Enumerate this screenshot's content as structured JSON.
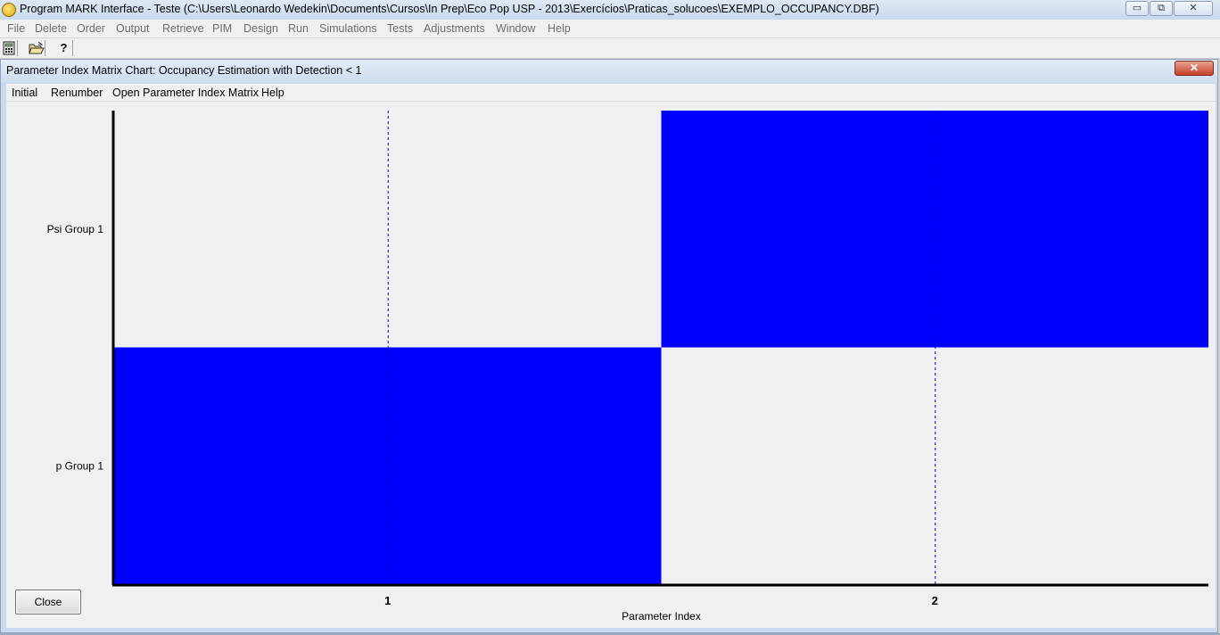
{
  "app": {
    "title": "Program MARK Interface - Teste  (C:\\Users\\Leonardo Wedekin\\Documents\\Cursos\\In Prep\\Eco Pop USP - 2013\\Exercícios\\Praticas_solucoes\\EXEMPLO_OCCUPANCY.DBF)",
    "window_controls": {
      "minimize": "▭",
      "restore": "⧉",
      "close": "✕"
    }
  },
  "menubar": {
    "items": [
      {
        "label": "File",
        "enabled": false
      },
      {
        "label": "Delete",
        "enabled": false
      },
      {
        "label": "Order",
        "enabled": false
      },
      {
        "label": "Output",
        "enabled": false
      },
      {
        "label": "Retrieve",
        "enabled": false
      },
      {
        "label": "PIM",
        "enabled": false
      },
      {
        "label": "Design",
        "enabled": false
      },
      {
        "label": "Run",
        "enabled": false
      },
      {
        "label": "Simulations",
        "enabled": false
      },
      {
        "label": "Tests",
        "enabled": false
      },
      {
        "label": "Adjustments",
        "enabled": false
      },
      {
        "label": "Window",
        "enabled": false
      },
      {
        "label": "Help",
        "enabled": false
      }
    ]
  },
  "toolbar": {
    "buttons": [
      {
        "icon": "calculator-icon"
      },
      {
        "icon": "open-folder-icon"
      },
      {
        "icon": "help-icon",
        "label": "?"
      }
    ]
  },
  "child_window": {
    "title": "Parameter Index Matrix Chart: Occupancy Estimation with Detection < 1",
    "close_glyph": "✕",
    "menu": [
      "Initial",
      "Renumber",
      "Open Parameter Index Matrix",
      "Help"
    ],
    "close_button_label": "Close"
  },
  "chart_data": {
    "type": "heatmap",
    "xlabel": "Parameter Index",
    "x_ticks": [
      "1",
      "2"
    ],
    "y_categories": [
      "p Group 1",
      "Psi Group 1"
    ],
    "cells": [
      {
        "row": "Psi Group 1",
        "x_range": [
          1.5,
          2.5
        ],
        "value": 2
      },
      {
        "row": "p Group 1",
        "x_range": [
          0.5,
          1.5
        ],
        "value": 1
      }
    ],
    "xlim": [
      0.5,
      2.5
    ],
    "fill_color": "#0000ff",
    "background_color": "#f0f0f0",
    "gridlines": "dashed-vertical"
  }
}
